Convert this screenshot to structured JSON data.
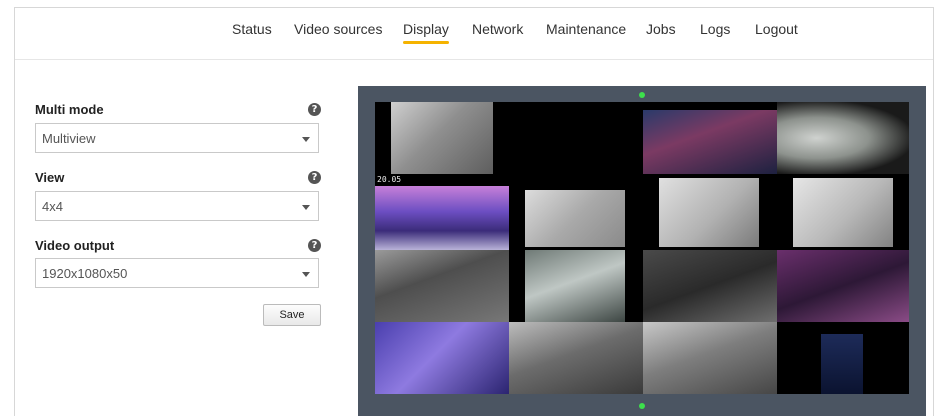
{
  "nav": {
    "items": [
      {
        "label": "Status",
        "active": false
      },
      {
        "label": "Video sources",
        "active": false
      },
      {
        "label": "Display",
        "active": true
      },
      {
        "label": "Network",
        "active": false
      },
      {
        "label": "Maintenance",
        "active": false
      },
      {
        "label": "Jobs",
        "active": false
      },
      {
        "label": "Logs",
        "active": false
      },
      {
        "label": "Logout",
        "active": false
      }
    ],
    "accent_color": "#f5b300"
  },
  "form": {
    "multi_mode": {
      "label": "Multi mode",
      "value": "Multiview",
      "help_icon": "question-circle-icon"
    },
    "view": {
      "label": "View",
      "value": "4x4",
      "help_icon": "question-circle-icon"
    },
    "video_output": {
      "label": "Video output",
      "value": "1920x1080x50",
      "help_icon": "question-circle-icon"
    },
    "save_label": "Save"
  },
  "preview": {
    "timestamp": "20.05",
    "handle_color": "#3de04c"
  }
}
